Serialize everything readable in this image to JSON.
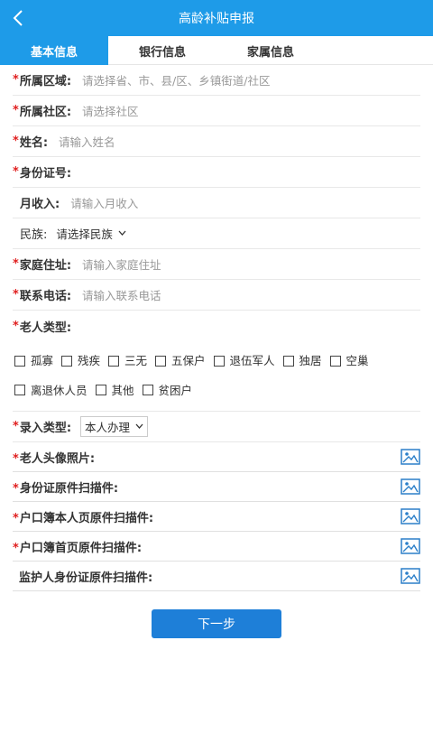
{
  "header": {
    "title": "高龄补贴申报"
  },
  "tabs": [
    {
      "label": "基本信息"
    },
    {
      "label": "银行信息"
    },
    {
      "label": "家属信息"
    }
  ],
  "fields": {
    "region": {
      "label": "所属区域:",
      "placeholder": "请选择省、市、县/区、乡镇街道/社区"
    },
    "community": {
      "label": "所属社区:",
      "placeholder": "请选择社区"
    },
    "name": {
      "label": "姓名:",
      "placeholder": "请输入姓名"
    },
    "idcard": {
      "label": "身份证号:"
    },
    "income": {
      "label": "月收入:",
      "placeholder": "请输入月收入"
    },
    "ethnic": {
      "label": "民族:",
      "value": "请选择民族"
    },
    "address": {
      "label": "家庭住址:",
      "placeholder": "请输入家庭住址"
    },
    "phone": {
      "label": "联系电话:",
      "placeholder": "请输入联系电话"
    },
    "elder_type": {
      "label": "老人类型:"
    },
    "entry_type": {
      "label": "录入类型:",
      "value": "本人办理"
    }
  },
  "elder_types": [
    "孤寡",
    "残疾",
    "三无",
    "五保户",
    "退伍军人",
    "独居",
    "空巢",
    "离退休人员",
    "其他",
    "贫困户"
  ],
  "uploads": [
    {
      "label": "老人头像照片:",
      "required": "*"
    },
    {
      "label": "身份证原件扫描件:",
      "required": "*"
    },
    {
      "label": "户口簿本人页原件扫描件:",
      "required": "*"
    },
    {
      "label": "户口簿首页原件扫描件:",
      "required": "*"
    },
    {
      "label": "监护人身份证原件扫描件:",
      "required": ""
    }
  ],
  "required_mark": "*",
  "next_button": "下一步",
  "colors": {
    "header_bg": "#1e9be8",
    "button_bg": "#1e7fd8",
    "required": "#e02020",
    "icon": "#2b7fc9"
  }
}
